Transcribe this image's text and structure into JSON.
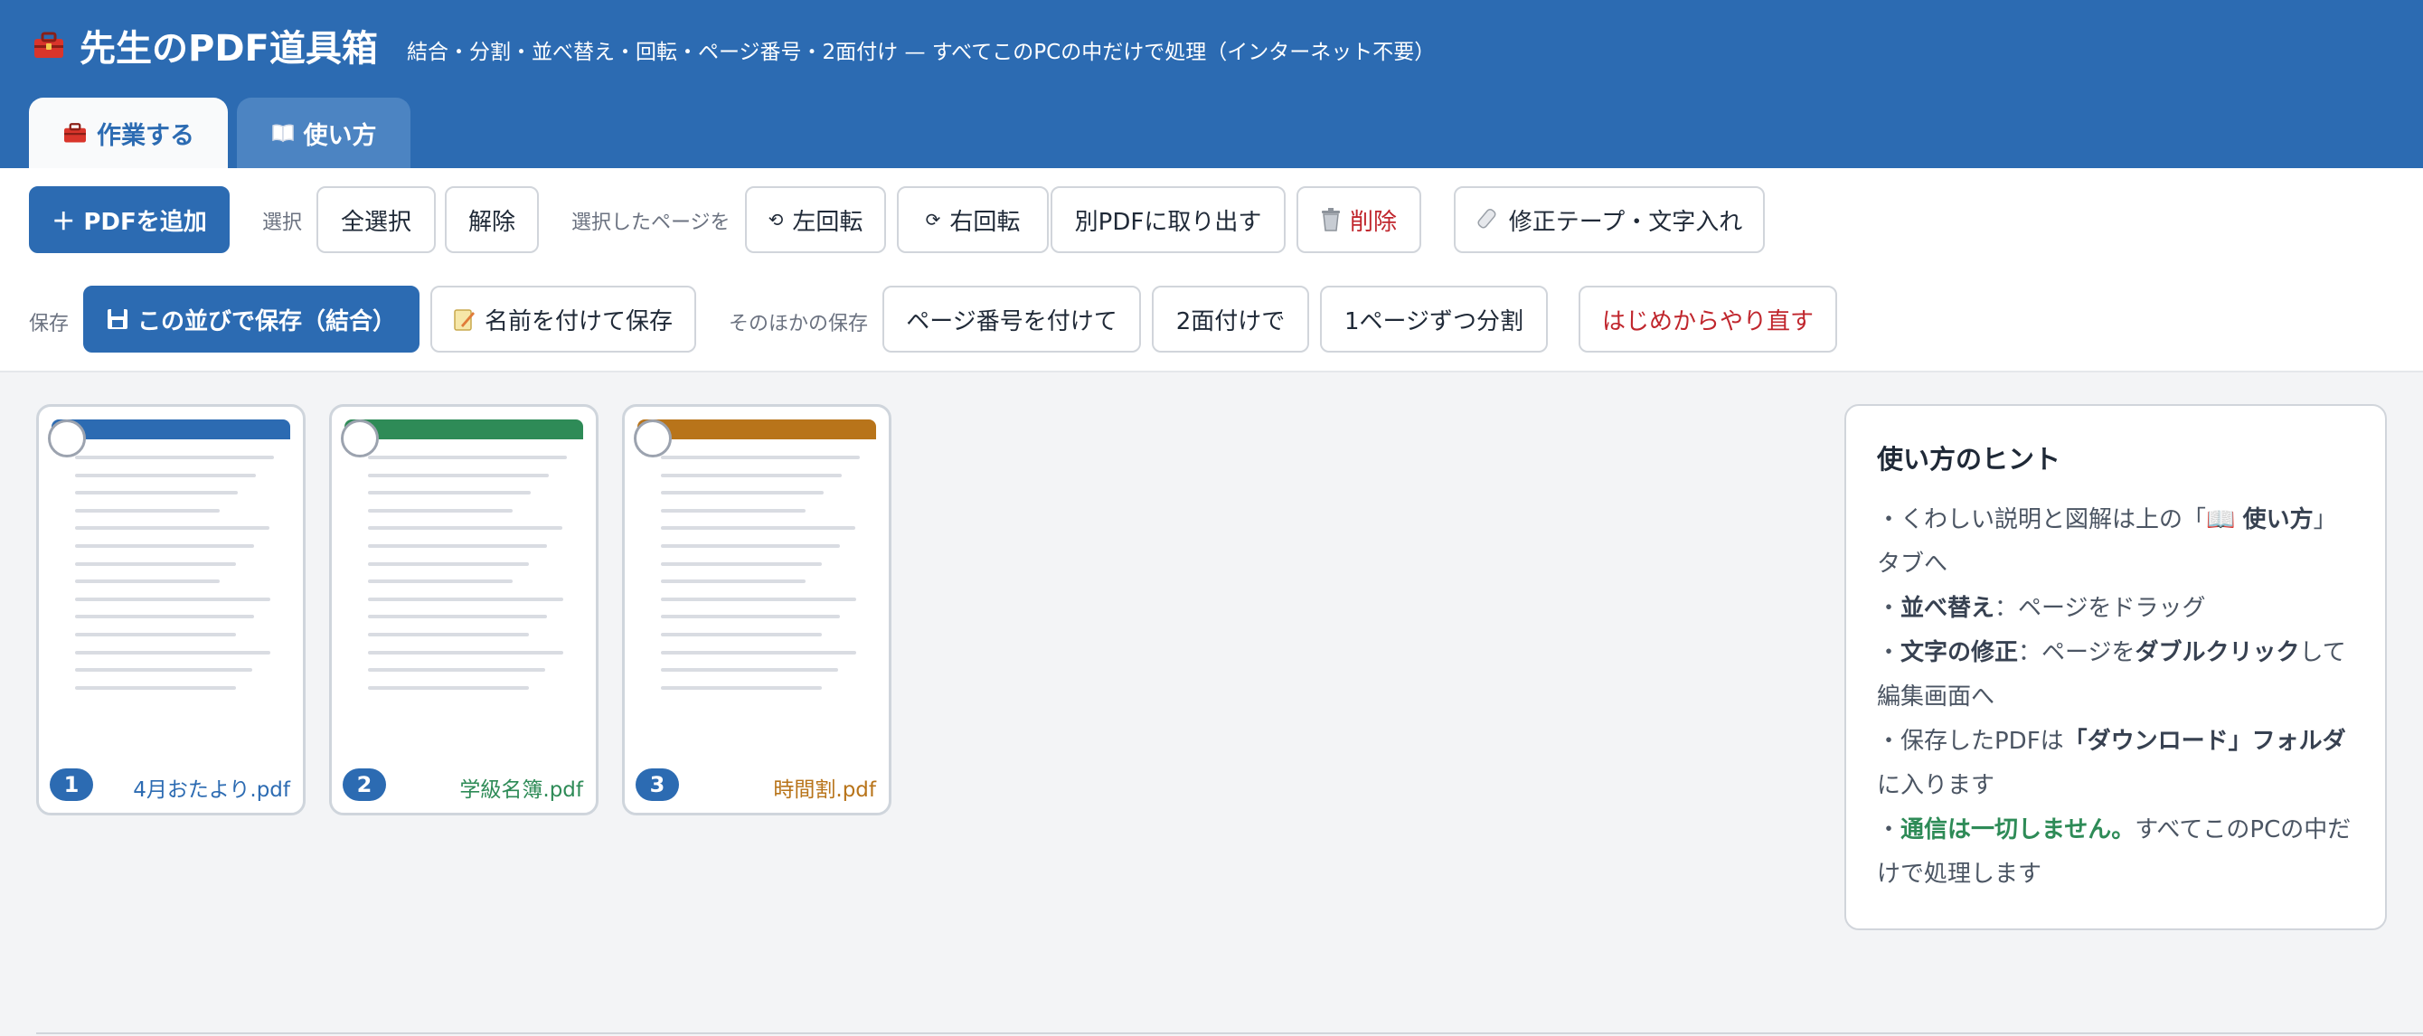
{
  "app": {
    "title": "先生のPDF道具箱",
    "subtitle": "結合・分割・並べ替え・回転・ページ番号・2面付け — すべてこのPCの中だけで処理（インターネット不要）",
    "title_icon": "toolbox-icon"
  },
  "tabs": [
    {
      "label": "作業する",
      "icon": "toolbox-icon",
      "active": true
    },
    {
      "label": "使い方",
      "icon": "book-icon",
      "active": false
    }
  ],
  "toolbar": {
    "add_pdf": "＋ PDFを追加",
    "select_label": "選択",
    "select_all": "全選択",
    "deselect": "解除",
    "selected_pages_label": "選択したページを",
    "rotate_left": "左回転",
    "rotate_right": "右回転",
    "extract": "別PDFに取り出す",
    "delete": "削除",
    "correction": "修正テープ・文字入れ",
    "save_label": "保存",
    "save_in_order": "この並びで保存（結合）",
    "save_as": "名前を付けて保存",
    "other_save_label": "そのほかの保存",
    "page_numbers": "ページ番号を付けて",
    "two_up": "2面付けで",
    "split": "1ページずつ分割",
    "reset": "はじめからやり直す"
  },
  "pages": [
    {
      "number": "1",
      "file": "4月おたより.pdf",
      "color": "#2c6bb2"
    },
    {
      "number": "2",
      "file": "学級名簿.pdf",
      "color": "#2e8b57"
    },
    {
      "number": "3",
      "file": "時間割.pdf",
      "color": "#b8741a"
    }
  ],
  "hint": {
    "title": "使い方のヒント",
    "l1_pre": "・くわしい説明と図解は上の「",
    "l1_bold": "使い方",
    "l1_post": "」タブへ",
    "l2_bold": "並べ替え",
    "l2_post": "：ページをドラッグ",
    "l3_bold": "文字の修正",
    "l3_mid": "：ページを",
    "l3_bold2": "ダブルクリック",
    "l3_post": "して編集画面へ",
    "l4_pre": "・保存したPDFは",
    "l4_bold": "「ダウンロード」フォルダ",
    "l4_post": "に入ります",
    "l5_green": "通信は一切しません。",
    "l5_post": "すべてこのPCの中だけで処理します"
  },
  "colors": {
    "brand": "#2c6bb2",
    "danger": "#c0262d",
    "success": "#2e8b57"
  }
}
